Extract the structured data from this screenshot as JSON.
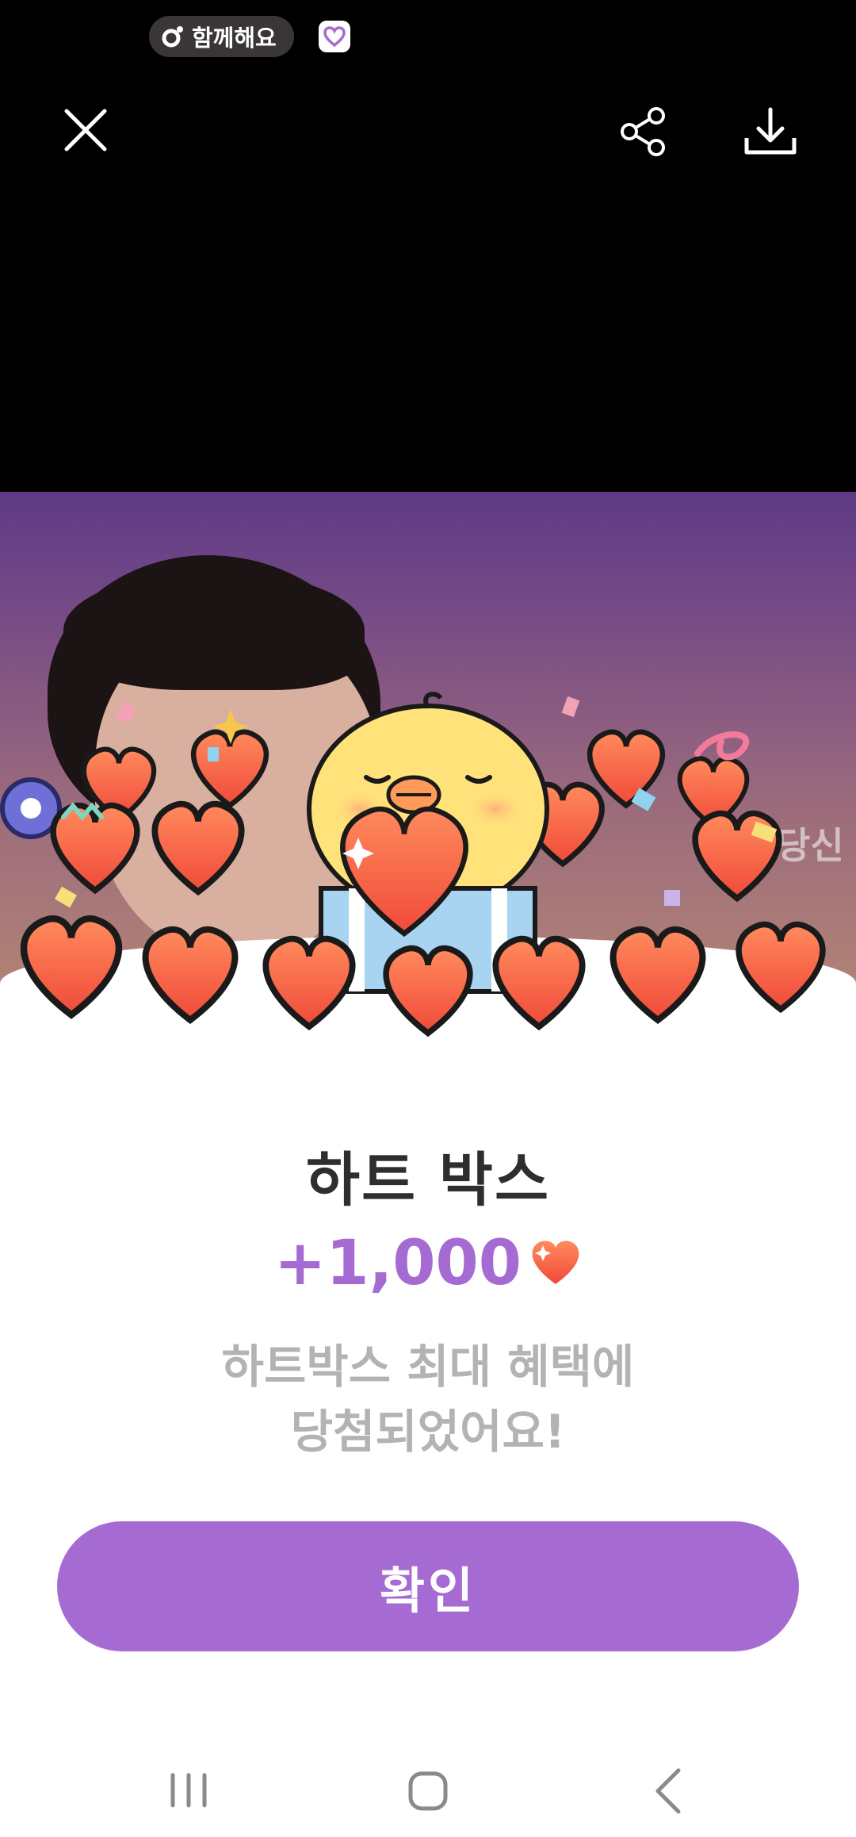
{
  "status_bar": {
    "pill_label": "함께해요"
  },
  "toolbar": {
    "close_icon": "close-icon",
    "share_icon": "share-icon",
    "download_icon": "download-icon"
  },
  "background_video": {
    "side_text": "당신"
  },
  "reward_popup": {
    "title": "하트 박스",
    "amount": "+1,000",
    "description_line1": "하트박스 최대 혜택에",
    "description_line2": "당첨되었어요!",
    "confirm_label": "확인"
  },
  "navigation_bar": {
    "recent_icon": "recent-apps-icon",
    "home_icon": "home-icon",
    "back_icon": "back-icon"
  },
  "colors": {
    "accent": "#a66bd3",
    "heart": "#f25a3a",
    "text_dark": "#2e2e2e",
    "text_muted": "#b3b3b3"
  }
}
